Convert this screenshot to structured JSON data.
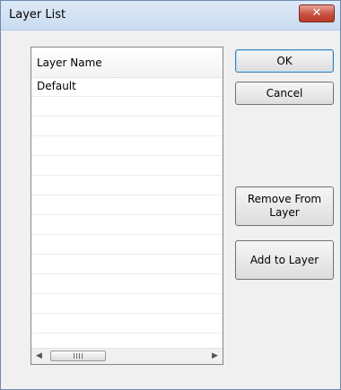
{
  "window": {
    "title": "Layer List",
    "close_glyph": "✕"
  },
  "list": {
    "header": "Layer Name",
    "rows": [
      "Default",
      "",
      "",
      "",
      "",
      "",
      "",
      "",
      "",
      "",
      "",
      "",
      ""
    ]
  },
  "scrollbar": {
    "left_arrow": "◀",
    "right_arrow": "▶"
  },
  "buttons": {
    "ok": "OK",
    "cancel": "Cancel",
    "remove": "Remove From Layer",
    "add": "Add to Layer"
  },
  "colors": {
    "title_bar": "#c9dcf1",
    "close_button": "#c9503e",
    "dialog_bg": "#f0f0f0"
  }
}
